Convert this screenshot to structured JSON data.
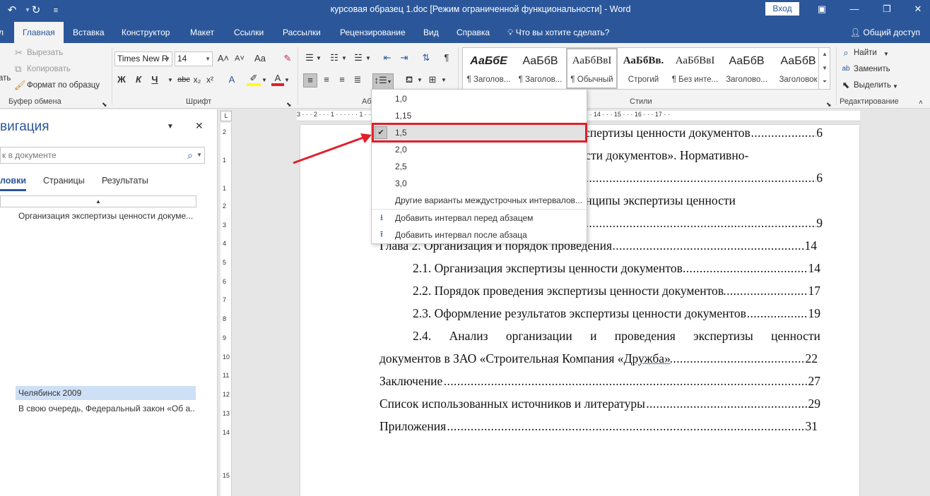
{
  "titlebar": {
    "title": "курсовая образец 1.doc [Режим ограниченной функциональности]  -  Word",
    "signin_label": "Вход",
    "icons": {
      "undo": "undo-icon",
      "redo": "redo-icon",
      "customize": "customize-qat-icon"
    }
  },
  "tabs": {
    "file": "л",
    "items": [
      "Главная",
      "Вставка",
      "Конструктор",
      "Макет",
      "Ссылки",
      "Рассылки",
      "Рецензирование",
      "Вид",
      "Справка"
    ],
    "tell_me": "Что вы хотите сделать?",
    "share": "Общий доступ"
  },
  "clipboard": {
    "cut": "Вырезать",
    "copy": "Копировать",
    "format_painter": "Формат по образцу",
    "group_label": "Буфер обмена",
    "paste_fragment": "ать"
  },
  "font": {
    "name": "Times New R",
    "size": "14",
    "group_label": "Шрифт",
    "grow": "A˄",
    "shrink": "A˅",
    "case": "Aa",
    "bold": "Ж",
    "italic": "К",
    "underline": "Ч",
    "strike": "abc",
    "sub": "x₂",
    "sup": "x²"
  },
  "paragraph": {
    "group_label": "Аб",
    "pilcrow": "¶"
  },
  "styles": {
    "group_label": "Стили",
    "items": [
      {
        "preview": "АаБбЕ",
        "name": "¶ Заголов..."
      },
      {
        "preview": "АаБбВ",
        "name": "¶ Заголов..."
      },
      {
        "preview": "АаБбВвІ",
        "name": "¶ Обычный"
      },
      {
        "preview": "АаБбВв.",
        "name": "Строгий"
      },
      {
        "preview": "АаБбВвІ",
        "name": "¶ Без инте..."
      },
      {
        "preview": "АаБбВ",
        "name": "Заголово..."
      },
      {
        "preview": "АаБбВ",
        "name": "Заголовок"
      }
    ]
  },
  "editing": {
    "find": "Найти",
    "replace": "Заменить",
    "select": "Выделить",
    "group_label": "Редактирование"
  },
  "nav": {
    "title": "вигация",
    "search_placeholder": "к в документе",
    "tabs": [
      "ловки",
      "Страницы",
      "Результаты"
    ],
    "items": [
      "Организация экспертизы ценности докуме...",
      "Челябинск 2009",
      "В свою очередь, Федеральный закон «Об а..."
    ]
  },
  "ruler": {
    "horizontal": "3 · · · 2 · · · 1 · · · · · · 1 · · · 2 · · · 3 · · · 4 · · · 5 · · · 6 · · · 7 · · · 8 · · · 9 · · · 10 · · · 11 · · · 12 · · · 13 · · · 14 · · · 15 · · · 16 · · · 17 · ·",
    "vertical": [
      "2",
      "1",
      "1",
      "2",
      "3",
      "4",
      "5",
      "6",
      "7",
      "8",
      "9",
      "10",
      "11",
      "12",
      "13",
      "14",
      "15"
    ],
    "corner": "L"
  },
  "document": {
    "lines": [
      {
        "text": "кспертизы ценности документов",
        "page": "6"
      },
      {
        "text": "ости документов». Нормативно-",
        "page": ""
      },
      {
        "text": "",
        "page": "6"
      },
      {
        "text": "инципы экспертизы ценности",
        "page": ""
      },
      {
        "text": "",
        "page": "9"
      },
      {
        "text": "Глава 2. Организация и порядок проведения",
        "page": "14"
      },
      {
        "text": "2.1. Организация экспертизы ценности документов",
        "page": "14"
      },
      {
        "text": "2.2. Порядок проведения экспертизы ценности документов",
        "page": "17"
      },
      {
        "text": "2.3. Оформление результатов экспертизы ценности документов",
        "page": "19"
      },
      {
        "text": "2.4. Анализ организации и проведения экспертизы ценности",
        "page": ""
      },
      {
        "text": "документов в ЗАО «Строительная Компания «",
        "underlined": "Дружба»",
        "page": "22"
      },
      {
        "text": "Заключение",
        "page": "27"
      },
      {
        "text": "Список использованных источников и литературы",
        "page": "29"
      },
      {
        "text": "Приложения",
        "page": "31"
      }
    ]
  },
  "spacing_menu": {
    "options": [
      "1,0",
      "1,15",
      "1,5",
      "2,0",
      "2,5",
      "3,0"
    ],
    "checked": "1,5",
    "more": "Другие варианты междустрочных интервалов...",
    "add_before": "Добавить интервал перед абзацем",
    "add_after": "Добавить интервал после абзаца"
  },
  "annotation": {
    "highlight_color": "#e0202a"
  },
  "colors": {
    "brand": "#2b579a",
    "ribbon_bg": "#f3f3f3"
  }
}
